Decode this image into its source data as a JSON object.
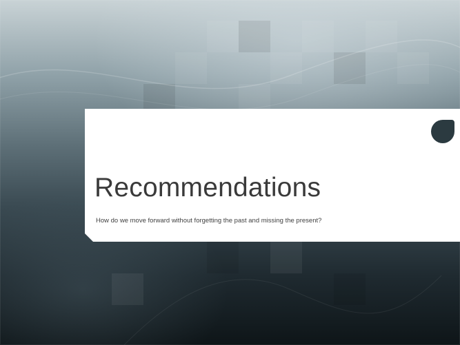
{
  "slide": {
    "title": "Recommendations",
    "subtitle": "How do we move forward without forgetting the past and missing the present?"
  },
  "colors": {
    "band_background": "#ffffff",
    "accent_shape": "#2b3a40",
    "title_text": "#3a3a3a",
    "background_top": "#c9d3d6",
    "background_bottom": "#0e1518"
  }
}
